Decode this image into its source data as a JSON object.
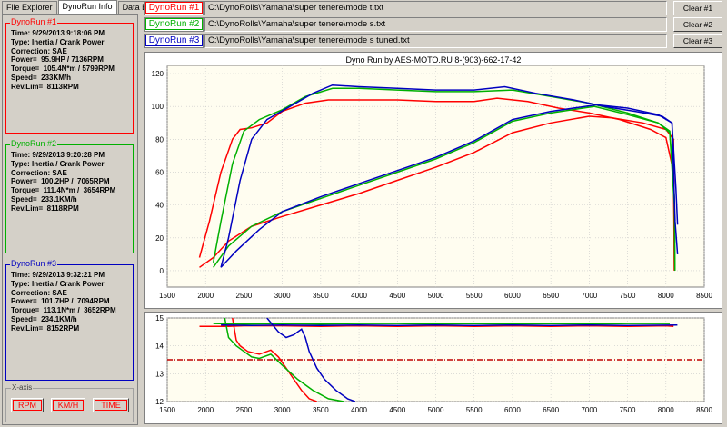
{
  "tabs": [
    {
      "label": "File Explorer",
      "active": false
    },
    {
      "label": "DynoRun Info",
      "active": true
    },
    {
      "label": "Data Export",
      "active": false
    }
  ],
  "runs": [
    {
      "label": "DynoRun #1",
      "color": "#ff0000",
      "path": "C:\\DynoRolls\\Yamaha\\super tenere\\mode t.txt",
      "clear_label": "Clear #1",
      "info": [
        "Time: 9/29/2013 9:18:06 PM",
        "Type: Inertia / Crank Power",
        "Correction: SAE",
        "Power=  95.9HP / 7136RPM",
        "Torque=  105.4N*m / 5799RPM",
        "Speed=  233KM/h",
        "Rev.Lim=  8113RPM"
      ]
    },
    {
      "label": "DynoRun #2",
      "color": "#00b000",
      "path": "C:\\DynoRolls\\Yamaha\\super tenere\\mode s.txt",
      "clear_label": "Clear #2",
      "info": [
        "Time: 9/29/2013 9:20:28 PM",
        "Type: Inertia / Crank Power",
        "Correction: SAE",
        "Power=  100.2HP /  7065RPM",
        "Torque=  111.4N*m /  3654RPM",
        "Speed=  233.1KM/h",
        "Rev.Lim=  8118RPM"
      ]
    },
    {
      "label": "DynoRun #3",
      "color": "#0000c0",
      "path": "C:\\DynoRolls\\Yamaha\\super tenere\\mode s tuned.txt",
      "clear_label": "Clear #3",
      "info": [
        "Time: 9/29/2013 9:32:21 PM",
        "Type: Inertia / Crank Power",
        "Correction: SAE",
        "Power=  101.7HP /  7094RPM",
        "Torque=  113.1N*m /  3652RPM",
        "Speed=  234.1KM/h",
        "Rev.Lim=  8152RPM"
      ]
    }
  ],
  "xaxis_group": {
    "label": "X-axis",
    "buttons": [
      "RPM",
      "KM/H",
      "TIME"
    ]
  },
  "chart_data": [
    {
      "type": "line",
      "title": "Dyno Run by AES-MOTO.RU    8-(903)-662-17-42",
      "xlim": [
        1500,
        8500
      ],
      "ylim": [
        -10,
        125
      ],
      "xticks": [
        1500,
        2000,
        2500,
        3000,
        3500,
        4000,
        4500,
        5000,
        5500,
        6000,
        6500,
        7000,
        7500,
        8000,
        8500
      ],
      "yticks": [
        0,
        20,
        40,
        60,
        80,
        100,
        120
      ],
      "grid": true,
      "series": [
        {
          "run": 1,
          "metric": "power",
          "color": "#ff0000",
          "points": [
            [
              1920,
              2
            ],
            [
              2100,
              8
            ],
            [
              2300,
              18
            ],
            [
              2600,
              27
            ],
            [
              3000,
              33
            ],
            [
              3500,
              40
            ],
            [
              4000,
              47
            ],
            [
              4500,
              55
            ],
            [
              5000,
              63
            ],
            [
              5500,
              72
            ],
            [
              6000,
              84
            ],
            [
              6500,
              90
            ],
            [
              7000,
              94
            ],
            [
              7300,
              93
            ],
            [
              7700,
              90
            ],
            [
              8000,
              86
            ],
            [
              8100,
              80
            ],
            [
              8110,
              0
            ]
          ]
        },
        {
          "run": 1,
          "metric": "torque",
          "color": "#ff0000",
          "points": [
            [
              1920,
              8
            ],
            [
              2050,
              30
            ],
            [
              2200,
              60
            ],
            [
              2350,
              80
            ],
            [
              2450,
              86
            ],
            [
              2600,
              87
            ],
            [
              2800,
              90
            ],
            [
              3000,
              97
            ],
            [
              3300,
              102
            ],
            [
              3600,
              104
            ],
            [
              4000,
              104
            ],
            [
              4500,
              104
            ],
            [
              5000,
              103
            ],
            [
              5500,
              103
            ],
            [
              5800,
              105
            ],
            [
              6200,
              103
            ],
            [
              6600,
              99
            ],
            [
              7000,
              96
            ],
            [
              7400,
              92
            ],
            [
              7800,
              86
            ],
            [
              8000,
              81
            ],
            [
              8100,
              60
            ],
            [
              8110,
              0
            ]
          ]
        },
        {
          "run": 2,
          "metric": "power",
          "color": "#00b000",
          "points": [
            [
              2100,
              2
            ],
            [
              2300,
              15
            ],
            [
              2600,
              27
            ],
            [
              3000,
              36
            ],
            [
              3500,
              44
            ],
            [
              4000,
              52
            ],
            [
              4500,
              60
            ],
            [
              5000,
              68
            ],
            [
              5500,
              78
            ],
            [
              6000,
              91
            ],
            [
              6500,
              96
            ],
            [
              7065,
              100
            ],
            [
              7500,
              95
            ],
            [
              7900,
              90
            ],
            [
              8050,
              84
            ],
            [
              8110,
              40
            ],
            [
              8118,
              0
            ]
          ]
        },
        {
          "run": 2,
          "metric": "torque",
          "color": "#00b000",
          "points": [
            [
              2100,
              5
            ],
            [
              2200,
              30
            ],
            [
              2350,
              65
            ],
            [
              2500,
              85
            ],
            [
              2700,
              92
            ],
            [
              3000,
              98
            ],
            [
              3300,
              106
            ],
            [
              3654,
              111
            ],
            [
              4000,
              111
            ],
            [
              4500,
              110
            ],
            [
              5000,
              109
            ],
            [
              5500,
              109
            ],
            [
              6000,
              110
            ],
            [
              6500,
              106
            ],
            [
              7000,
              102
            ],
            [
              7500,
              96
            ],
            [
              7900,
              90
            ],
            [
              8050,
              85
            ],
            [
              8110,
              45
            ],
            [
              8118,
              0
            ]
          ]
        },
        {
          "run": 3,
          "metric": "power",
          "color": "#0000c0",
          "points": [
            [
              2200,
              2
            ],
            [
              2400,
              12
            ],
            [
              2700,
              25
            ],
            [
              3000,
              36
            ],
            [
              3500,
              45
            ],
            [
              4000,
              53
            ],
            [
              4500,
              61
            ],
            [
              5000,
              69
            ],
            [
              5500,
              79
            ],
            [
              6000,
              92
            ],
            [
              6500,
              97
            ],
            [
              7094,
              101
            ],
            [
              7500,
              99
            ],
            [
              7900,
              95
            ],
            [
              8080,
              90
            ],
            [
              8130,
              50
            ],
            [
              8152,
              28
            ]
          ]
        },
        {
          "run": 3,
          "metric": "torque",
          "color": "#0000c0",
          "points": [
            [
              2200,
              2
            ],
            [
              2300,
              20
            ],
            [
              2450,
              55
            ],
            [
              2600,
              80
            ],
            [
              2800,
              92
            ],
            [
              3100,
              100
            ],
            [
              3400,
              108
            ],
            [
              3652,
              113
            ],
            [
              4000,
              112
            ],
            [
              4500,
              111
            ],
            [
              5000,
              110
            ],
            [
              5500,
              110
            ],
            [
              5900,
              112
            ],
            [
              6300,
              108
            ],
            [
              6800,
              104
            ],
            [
              7200,
              100
            ],
            [
              7600,
              97
            ],
            [
              7950,
              94
            ],
            [
              8080,
              90
            ],
            [
              8120,
              30
            ],
            [
              8152,
              10
            ]
          ]
        }
      ]
    },
    {
      "type": "line",
      "title": "",
      "xlim": [
        1500,
        8500
      ],
      "ylim": [
        12,
        15
      ],
      "xticks": [
        1500,
        2000,
        2500,
        3000,
        3500,
        4000,
        4500,
        5000,
        5500,
        6000,
        6500,
        7000,
        7500,
        8000,
        8500
      ],
      "yticks": [
        12,
        13,
        14,
        15
      ],
      "grid": true,
      "reference_line": {
        "y": 13.5,
        "color": "#c00000",
        "style": "dash-dot"
      },
      "series": [
        {
          "run": 1,
          "metric": "afr_target",
          "color": "#ff0000",
          "points": [
            [
              1920,
              14.7
            ],
            [
              2300,
              14.7
            ],
            [
              2500,
              14.72
            ],
            [
              3000,
              14.72
            ],
            [
              3500,
              14.7
            ],
            [
              4000,
              14.72
            ],
            [
              4500,
              14.7
            ],
            [
              5000,
              14.72
            ],
            [
              5500,
              14.7
            ],
            [
              6000,
              14.72
            ],
            [
              6500,
              14.7
            ],
            [
              7000,
              14.72
            ],
            [
              7500,
              14.7
            ],
            [
              8000,
              14.72
            ],
            [
              8100,
              14.7
            ]
          ]
        },
        {
          "run": 1,
          "metric": "afr",
          "color": "#ff0000",
          "points": [
            [
              2350,
              15
            ],
            [
              2400,
              14.2
            ],
            [
              2450,
              14.0
            ],
            [
              2550,
              13.8
            ],
            [
              2700,
              13.7
            ],
            [
              2850,
              13.85
            ],
            [
              2950,
              13.6
            ],
            [
              3050,
              13.2
            ],
            [
              3150,
              12.8
            ],
            [
              3250,
              12.4
            ],
            [
              3350,
              12.1
            ],
            [
              3450,
              12
            ]
          ]
        },
        {
          "run": 2,
          "metric": "afr_target",
          "color": "#00b000",
          "points": [
            [
              2100,
              14.8
            ],
            [
              2500,
              14.78
            ],
            [
              3000,
              14.8
            ],
            [
              3500,
              14.78
            ],
            [
              4000,
              14.8
            ],
            [
              4500,
              14.8
            ],
            [
              5000,
              14.78
            ],
            [
              5500,
              14.8
            ],
            [
              6000,
              14.78
            ],
            [
              6500,
              14.8
            ],
            [
              7000,
              14.78
            ],
            [
              7500,
              14.8
            ],
            [
              8050,
              14.8
            ]
          ]
        },
        {
          "run": 2,
          "metric": "afr",
          "color": "#00b000",
          "points": [
            [
              2250,
              15
            ],
            [
              2300,
              14.3
            ],
            [
              2400,
              14.0
            ],
            [
              2500,
              13.8
            ],
            [
              2600,
              13.6
            ],
            [
              2700,
              13.55
            ],
            [
              2850,
              13.7
            ],
            [
              3000,
              13.3
            ],
            [
              3200,
              12.8
            ],
            [
              3400,
              12.4
            ],
            [
              3600,
              12.1
            ],
            [
              3800,
              12
            ]
          ]
        },
        {
          "run": 3,
          "metric": "afr_target",
          "color": "#0000c0",
          "points": [
            [
              2200,
              14.75
            ],
            [
              2600,
              14.73
            ],
            [
              3000,
              14.75
            ],
            [
              3500,
              14.73
            ],
            [
              4000,
              14.75
            ],
            [
              4500,
              14.73
            ],
            [
              5000,
              14.75
            ],
            [
              5500,
              14.73
            ],
            [
              6000,
              14.75
            ],
            [
              6500,
              14.73
            ],
            [
              7000,
              14.75
            ],
            [
              7500,
              14.73
            ],
            [
              8150,
              14.75
            ]
          ]
        },
        {
          "run": 3,
          "metric": "afr",
          "color": "#0000c0",
          "points": [
            [
              2800,
              15
            ],
            [
              2950,
              14.5
            ],
            [
              3050,
              14.3
            ],
            [
              3150,
              14.4
            ],
            [
              3250,
              14.6
            ],
            [
              3300,
              14.3
            ],
            [
              3350,
              13.8
            ],
            [
              3450,
              13.2
            ],
            [
              3550,
              12.8
            ],
            [
              3700,
              12.4
            ],
            [
              3850,
              12.1
            ],
            [
              3950,
              12
            ]
          ]
        }
      ]
    }
  ]
}
